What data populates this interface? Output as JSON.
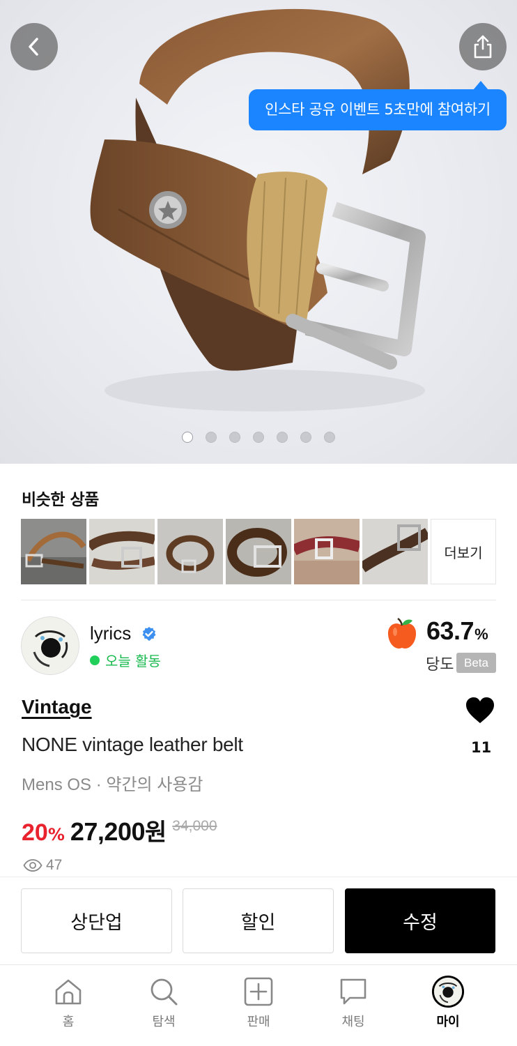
{
  "hero": {
    "back_icon": "chevron-left-icon",
    "share_icon": "share-icon",
    "tooltip": "인스타 공유 이벤트 5초만에 참여하기",
    "image_count": 7,
    "active_image_index": 0
  },
  "similar": {
    "title": "비슷한 상품",
    "thumbnail_count": 6,
    "more_label": "더보기"
  },
  "seller": {
    "name": "lyrics",
    "verified": true,
    "status": "오늘 활동",
    "rating": "63.7",
    "rating_unit": "%",
    "rating_label": "당도",
    "beta_badge": "Beta"
  },
  "product": {
    "brand": "Vintage",
    "title": "NONE vintage leather belt",
    "meta": "Mens OS · 약간의 사용감",
    "discount": "20",
    "discount_unit": "%",
    "price": "27,200",
    "price_unit": "원",
    "original_price": "34,000",
    "like_count": "11",
    "views": "47"
  },
  "actions": {
    "bump": "상단업",
    "discount": "할인",
    "edit": "수정"
  },
  "tabs": [
    {
      "label": "홈",
      "icon": "home-icon"
    },
    {
      "label": "탐색",
      "icon": "search-icon"
    },
    {
      "label": "판매",
      "icon": "plus-square-icon"
    },
    {
      "label": "채팅",
      "icon": "chat-icon"
    },
    {
      "label": "마이",
      "icon": "profile-avatar-icon",
      "active": true
    }
  ],
  "colors": {
    "tooltip_blue": "#1a85ff",
    "discount_red": "#e8232e",
    "status_green": "#1fcf5a",
    "primary_button": "#000000"
  }
}
